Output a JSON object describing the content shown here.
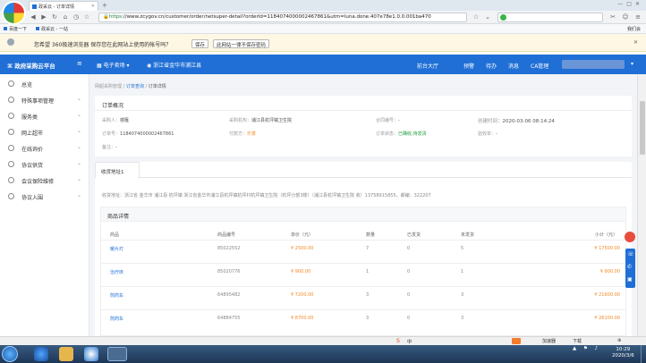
{
  "browser": {
    "tab_title": "政采云 - 订单详情",
    "url_secure": "https",
    "url_rest": "://www.zcygov.cn/customer/order/netsuper-detail?orderId=1184074000002467861&utm=luna.done.407e78e1.0.0.001ba470",
    "bookmarks": [
      "百度一下",
      "政采云 - 一站"
    ],
    "notification": "您希望 360极速浏览器 保存您在此网站上使用的帐号吗？",
    "save_btn": "保存",
    "never_btn": "此网站一律不保存密码",
    "right_label": "我们会"
  },
  "header": {
    "logo": "政府采购云平台",
    "mall": "电子卖场",
    "region": "浙江省金华市浦江县",
    "links": [
      "前台大厅",
      "预警",
      "待办",
      "消息",
      "CA管理"
    ]
  },
  "sidebar": {
    "items": [
      {
        "label": "总览",
        "arrow": ""
      },
      {
        "label": "特殊事项管理",
        "arrow": "⌄"
      },
      {
        "label": "服务类",
        "arrow": "⌄"
      },
      {
        "label": "网上超市",
        "arrow": "⌄"
      },
      {
        "label": "在线询价",
        "arrow": "⌄"
      },
      {
        "label": "协议供货",
        "arrow": "⌄"
      },
      {
        "label": "会议保险维修",
        "arrow": "⌄"
      },
      {
        "label": "协议入围",
        "arrow": "⌄"
      }
    ]
  },
  "breadcrumb": {
    "a": "网超采购管理",
    "b": "订单查询",
    "c": "订单详情"
  },
  "overview": {
    "title": "订单概况",
    "buyer_label": "采购人：",
    "buyer": "楼雁",
    "org_label": "采购机构：",
    "org": "浦江县杭坪镇卫生院",
    "contract_label": "合同编号：",
    "contract": "-",
    "created_label": "创建时间：",
    "created": "2020-03-06 08:14:24",
    "order_label": "订单号：",
    "order": "1184074000002467861",
    "pay_label": "付款方：",
    "pay": "乐意",
    "status_label": "订单状态：",
    "status": "已确收,待发货",
    "budget_label": "验收单：",
    "budget": "-",
    "remark_label": "备注：",
    "remark": "-"
  },
  "tabs": [
    "收货地址1"
  ],
  "address": {
    "label": "收货地址：",
    "text": "浙江省 金华市 浦江县 杭坪镇 浙江省金华市浦江县杭坪镇杭坪村杭坪镇卫生院（杭坪分部3楼）（浦江县杭坪镇卫生院 收）13758915855，邮编：322207"
  },
  "goods": {
    "title": "商品详情",
    "headers": [
      "商品",
      "商品编号",
      "单价（元）",
      "数量",
      "已发货",
      "未发货",
      "小计（元）"
    ],
    "rows": [
      {
        "name": "暖片灯",
        "code": "85022552",
        "price": "¥ 2500.00",
        "qty": "7",
        "sent": "0",
        "unsent": "5",
        "sub": "¥ 17500.00"
      },
      {
        "name": "治疗床",
        "code": "85020776",
        "price": "¥ 900.00",
        "qty": "1",
        "sent": "0",
        "unsent": "1",
        "sub": "¥ 900.00"
      },
      {
        "name": "煎药车",
        "code": "64895482",
        "price": "¥ 7200.00",
        "qty": "3",
        "sent": "0",
        "unsent": "3",
        "sub": "¥ 21600.00"
      },
      {
        "name": "煎药车",
        "code": "64884755",
        "price": "¥ 8700.00",
        "qty": "3",
        "sent": "0",
        "unsent": "3",
        "sub": "¥ 26100.00"
      }
    ]
  },
  "taskbar": {
    "ime": "中",
    "time": "10:29",
    "date": "2020/3/6",
    "tray_text": "加速器",
    "download": "下载"
  },
  "colors": {
    "brand": "#1f6fd6",
    "price": "#f08a24",
    "status": "#1a9e3c",
    "link": "#1f6fd6"
  }
}
